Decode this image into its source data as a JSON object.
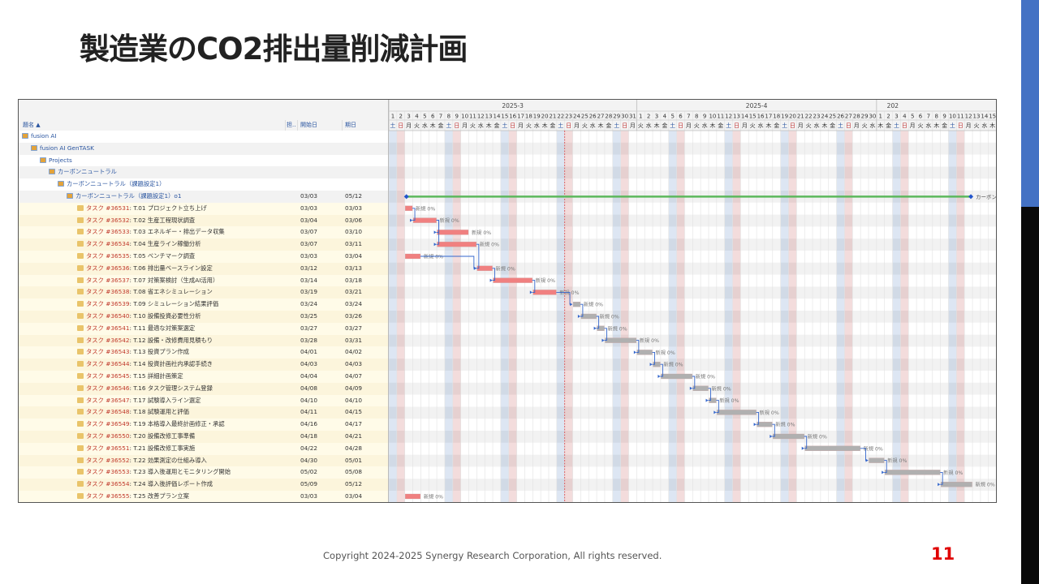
{
  "slide": {
    "title": "製造業のCO2排出量削減計画",
    "footer": "Copyright 2024-2025 Synergy Research Corporation, All rights reserved.",
    "page_number": "11",
    "accent_color": "#4472c4"
  },
  "gantt": {
    "columns": {
      "name": "題名 ▲",
      "assignee": "担..",
      "start": "開始日",
      "due": "期日"
    },
    "months": [
      "2025-3",
      "2025-4",
      "202"
    ],
    "weekdays": [
      "土",
      "日",
      "月",
      "火",
      "水",
      "木",
      "金"
    ],
    "bar_label": "新規 0%",
    "milestone_label": "カーボンニ",
    "colors": {
      "overdue_bar": "#f08080",
      "future_bar": "#b0b0b0",
      "summary_bar": "#5cb85c",
      "link": "#3366cc",
      "today_line": "#e04040"
    },
    "tree": [
      {
        "indent": 0,
        "label": "fusion AI"
      },
      {
        "indent": 1,
        "label": "fusion AI GenTASK"
      },
      {
        "indent": 2,
        "label": "Projects"
      },
      {
        "indent": 3,
        "label": "カーボンニュートラル"
      },
      {
        "indent": 4,
        "label": "カーボンニュートラル（課題設定1）"
      },
      {
        "indent": 5,
        "label": "カーボンニュートラル（課題設定1）o1",
        "start": "03/03",
        "due": "05/12"
      }
    ],
    "tasks": [
      {
        "prefix": "タスク",
        "id": "#36531",
        "title": ": T.01 プロジェクト立ち上げ",
        "start": "03/03",
        "due": "03/03"
      },
      {
        "prefix": "タスク",
        "id": "#36532",
        "title": ": T.02 生産工程現状調査",
        "start": "03/04",
        "due": "03/06"
      },
      {
        "prefix": "タスク",
        "id": "#36533",
        "title": ": T.03 エネルギー・排出データ収集",
        "start": "03/07",
        "due": "03/10"
      },
      {
        "prefix": "タスク",
        "id": "#36534",
        "title": ": T.04 生産ライン稼働分析",
        "start": "03/07",
        "due": "03/11"
      },
      {
        "prefix": "タスク",
        "id": "#36535",
        "title": ": T.05 ベンチマーク調査",
        "start": "03/03",
        "due": "03/04"
      },
      {
        "prefix": "タスク",
        "id": "#36536",
        "title": ": T.06 排出量ベースライン設定",
        "start": "03/12",
        "due": "03/13"
      },
      {
        "prefix": "タスク",
        "id": "#36537",
        "title": ": T.07 対策案検討（生成AI活用）",
        "start": "03/14",
        "due": "03/18"
      },
      {
        "prefix": "タスク",
        "id": "#36538",
        "title": ": T.08 省エネシミュレーション",
        "start": "03/19",
        "due": "03/21"
      },
      {
        "prefix": "タスク",
        "id": "#36539",
        "title": ": T.09 シミュレーション結果評価",
        "start": "03/24",
        "due": "03/24"
      },
      {
        "prefix": "タスク",
        "id": "#36540",
        "title": ": T.10 設備投資必要性分析",
        "start": "03/25",
        "due": "03/26"
      },
      {
        "prefix": "タスク",
        "id": "#36541",
        "title": ": T.11 最適な対策案選定",
        "start": "03/27",
        "due": "03/27"
      },
      {
        "prefix": "タスク",
        "id": "#36542",
        "title": ": T.12 設備・改修費用見積もり",
        "start": "03/28",
        "due": "03/31"
      },
      {
        "prefix": "タスク",
        "id": "#36543",
        "title": ": T.13 投資プラン作成",
        "start": "04/01",
        "due": "04/02"
      },
      {
        "prefix": "タスク",
        "id": "#36544",
        "title": ": T.14 投資計画社内承認手続き",
        "start": "04/03",
        "due": "04/03"
      },
      {
        "prefix": "タスク",
        "id": "#36545",
        "title": ": T.15 詳細計画策定",
        "start": "04/04",
        "due": "04/07"
      },
      {
        "prefix": "タスク",
        "id": "#36546",
        "title": ": T.16 タスク管理システム登録",
        "start": "04/08",
        "due": "04/09"
      },
      {
        "prefix": "タスク",
        "id": "#36547",
        "title": ": T.17 試験導入ライン選定",
        "start": "04/10",
        "due": "04/10"
      },
      {
        "prefix": "タスク",
        "id": "#36548",
        "title": ": T.18 試験運用と評価",
        "start": "04/11",
        "due": "04/15"
      },
      {
        "prefix": "タスク",
        "id": "#36549",
        "title": ": T.19 本格導入最終計画修正・承認",
        "start": "04/16",
        "due": "04/17"
      },
      {
        "prefix": "タスク",
        "id": "#36550",
        "title": ": T.20 設備改修工事準備",
        "start": "04/18",
        "due": "04/21"
      },
      {
        "prefix": "タスク",
        "id": "#36551",
        "title": ": T.21 設備改修工事実施",
        "start": "04/22",
        "due": "04/28"
      },
      {
        "prefix": "タスク",
        "id": "#36552",
        "title": ": T.22 効果測定の仕組み導入",
        "start": "04/30",
        "due": "05/01"
      },
      {
        "prefix": "タスク",
        "id": "#36553",
        "title": ": T.23 導入後運用とモニタリング開始",
        "start": "05/02",
        "due": "05/08"
      },
      {
        "prefix": "タスク",
        "id": "#36554",
        "title": ": T.24 導入後評価レポート作成",
        "start": "05/09",
        "due": "05/12"
      },
      {
        "prefix": "タスク",
        "id": "#36555",
        "title": ": T.25 改善プラン立案",
        "start": "03/03",
        "due": "03/04"
      }
    ]
  }
}
